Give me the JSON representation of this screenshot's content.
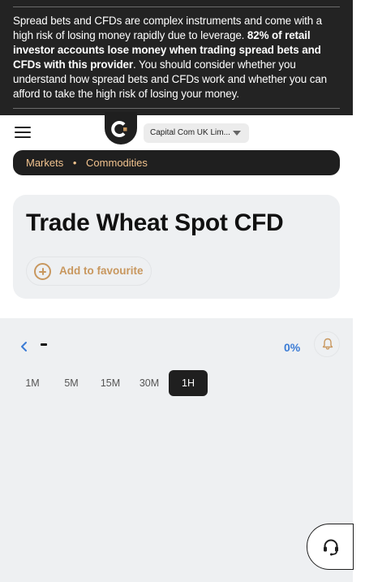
{
  "risk_warning": {
    "text_before": "Spread bets and CFDs are complex instruments and come with a high risk of losing money rapidly due to leverage. ",
    "text_bold": "82% of retail investor accounts lose money when trading spread bets and CFDs with this provider",
    "text_after": ". You should consider whether you understand how spread bets and CFDs work and whether you can afford to take the high risk of losing your money."
  },
  "header": {
    "entity_selector": "Capital Com UK Lim..."
  },
  "breadcrumb": {
    "items": [
      "Markets",
      "Commodities"
    ],
    "separator": "•"
  },
  "instrument": {
    "title": "Trade Wheat Spot CFD",
    "favourite_label": "Add to favourite"
  },
  "chart": {
    "price": "-",
    "change": "0%",
    "timeframes": [
      "1M",
      "5M",
      "15M",
      "30M",
      "1H"
    ],
    "active_timeframe": "1H"
  },
  "colors": {
    "dark": "#1f1f1f",
    "accent": "#c8975e",
    "breadcrumb_text": "#f3c48f",
    "change_blue": "#3a7bd5",
    "panel": "#eef0f2"
  },
  "icons": [
    "menu-icon",
    "capital-com-logo-icon",
    "chevron-down-icon",
    "plus-circle-icon",
    "chevron-left-icon",
    "bell-icon",
    "headset-icon"
  ]
}
